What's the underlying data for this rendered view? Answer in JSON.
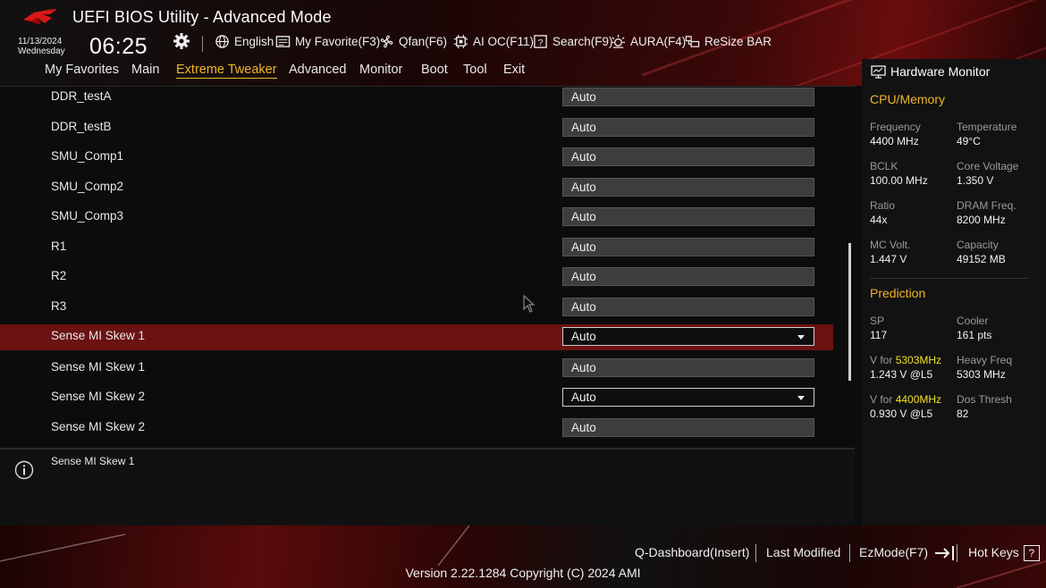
{
  "header": {
    "title": "UEFI BIOS Utility - Advanced Mode",
    "date": "11/13/2024",
    "weekday": "Wednesday",
    "time": "06:25",
    "toolbar": {
      "language": "English",
      "my_favorite": "My Favorite(F3)",
      "qfan": "Qfan(F6)",
      "ai_oc": "AI OC(F11)",
      "search": "Search(F9)",
      "aura": "AURA(F4)",
      "resize_bar": "ReSize BAR"
    }
  },
  "nav": {
    "tabs": [
      "My Favorites",
      "Main",
      "Extreme Tweaker",
      "Advanced",
      "Monitor",
      "Boot",
      "Tool",
      "Exit"
    ],
    "active": "Extreme Tweaker"
  },
  "settings": [
    {
      "label": "DDR_testA",
      "value": "Auto"
    },
    {
      "label": "DDR_testB",
      "value": "Auto"
    },
    {
      "label": "SMU_Comp1",
      "value": "Auto"
    },
    {
      "label": "SMU_Comp2",
      "value": "Auto"
    },
    {
      "label": "SMU_Comp3",
      "value": "Auto"
    },
    {
      "label": "R1",
      "value": "Auto"
    },
    {
      "label": "R2",
      "value": "Auto"
    },
    {
      "label": "R3",
      "value": "Auto"
    },
    {
      "label": "Sense MI Skew 1",
      "value": "Auto",
      "selected": true,
      "dropdown": true
    },
    {
      "label": "Sense MI Skew 1",
      "value": "Auto"
    },
    {
      "label": "Sense MI Skew 2",
      "value": "Auto",
      "dropdown": true
    },
    {
      "label": "Sense MI Skew 2",
      "value": "Auto"
    }
  ],
  "help": {
    "text": "Sense MI Skew 1"
  },
  "hardware_monitor": {
    "title": "Hardware Monitor",
    "cpu_memory": {
      "title": "CPU/Memory",
      "frequency_label": "Frequency",
      "frequency": "4400 MHz",
      "temperature_label": "Temperature",
      "temperature": "49°C",
      "bclk_label": "BCLK",
      "bclk": "100.00 MHz",
      "core_voltage_label": "Core Voltage",
      "core_voltage": "1.350 V",
      "ratio_label": "Ratio",
      "ratio": "44x",
      "dram_freq_label": "DRAM Freq.",
      "dram_freq": "8200 MHz",
      "mc_volt_label": "MC Volt.",
      "mc_volt": "1.447 V",
      "capacity_label": "Capacity",
      "capacity": "49152 MB"
    },
    "prediction": {
      "title": "Prediction",
      "sp_label": "SP",
      "sp": "117",
      "cooler_label": "Cooler",
      "cooler": "161 pts",
      "v_for_label": "V for",
      "v_for_1_freq": "5303MHz",
      "v_for_1": "1.243 V @L5",
      "heavy_freq_label": "Heavy Freq",
      "heavy_freq": "5303 MHz",
      "v_for_2_freq": "4400MHz",
      "v_for_2": "0.930 V @L5",
      "dos_thresh_label": "Dos Thresh",
      "dos_thresh": "82"
    }
  },
  "footer": {
    "q_dashboard": "Q-Dashboard(Insert)",
    "last_modified": "Last Modified",
    "ezmode": "EzMode(F7)",
    "hot_keys": "Hot Keys",
    "hot_keys_key": "?",
    "copyright": "Version 2.22.1284 Copyright (C) 2024 AMI"
  },
  "colors": {
    "accent": "#f0b628",
    "selected_row": "#6b1212",
    "highlight": "#f0e02a"
  }
}
